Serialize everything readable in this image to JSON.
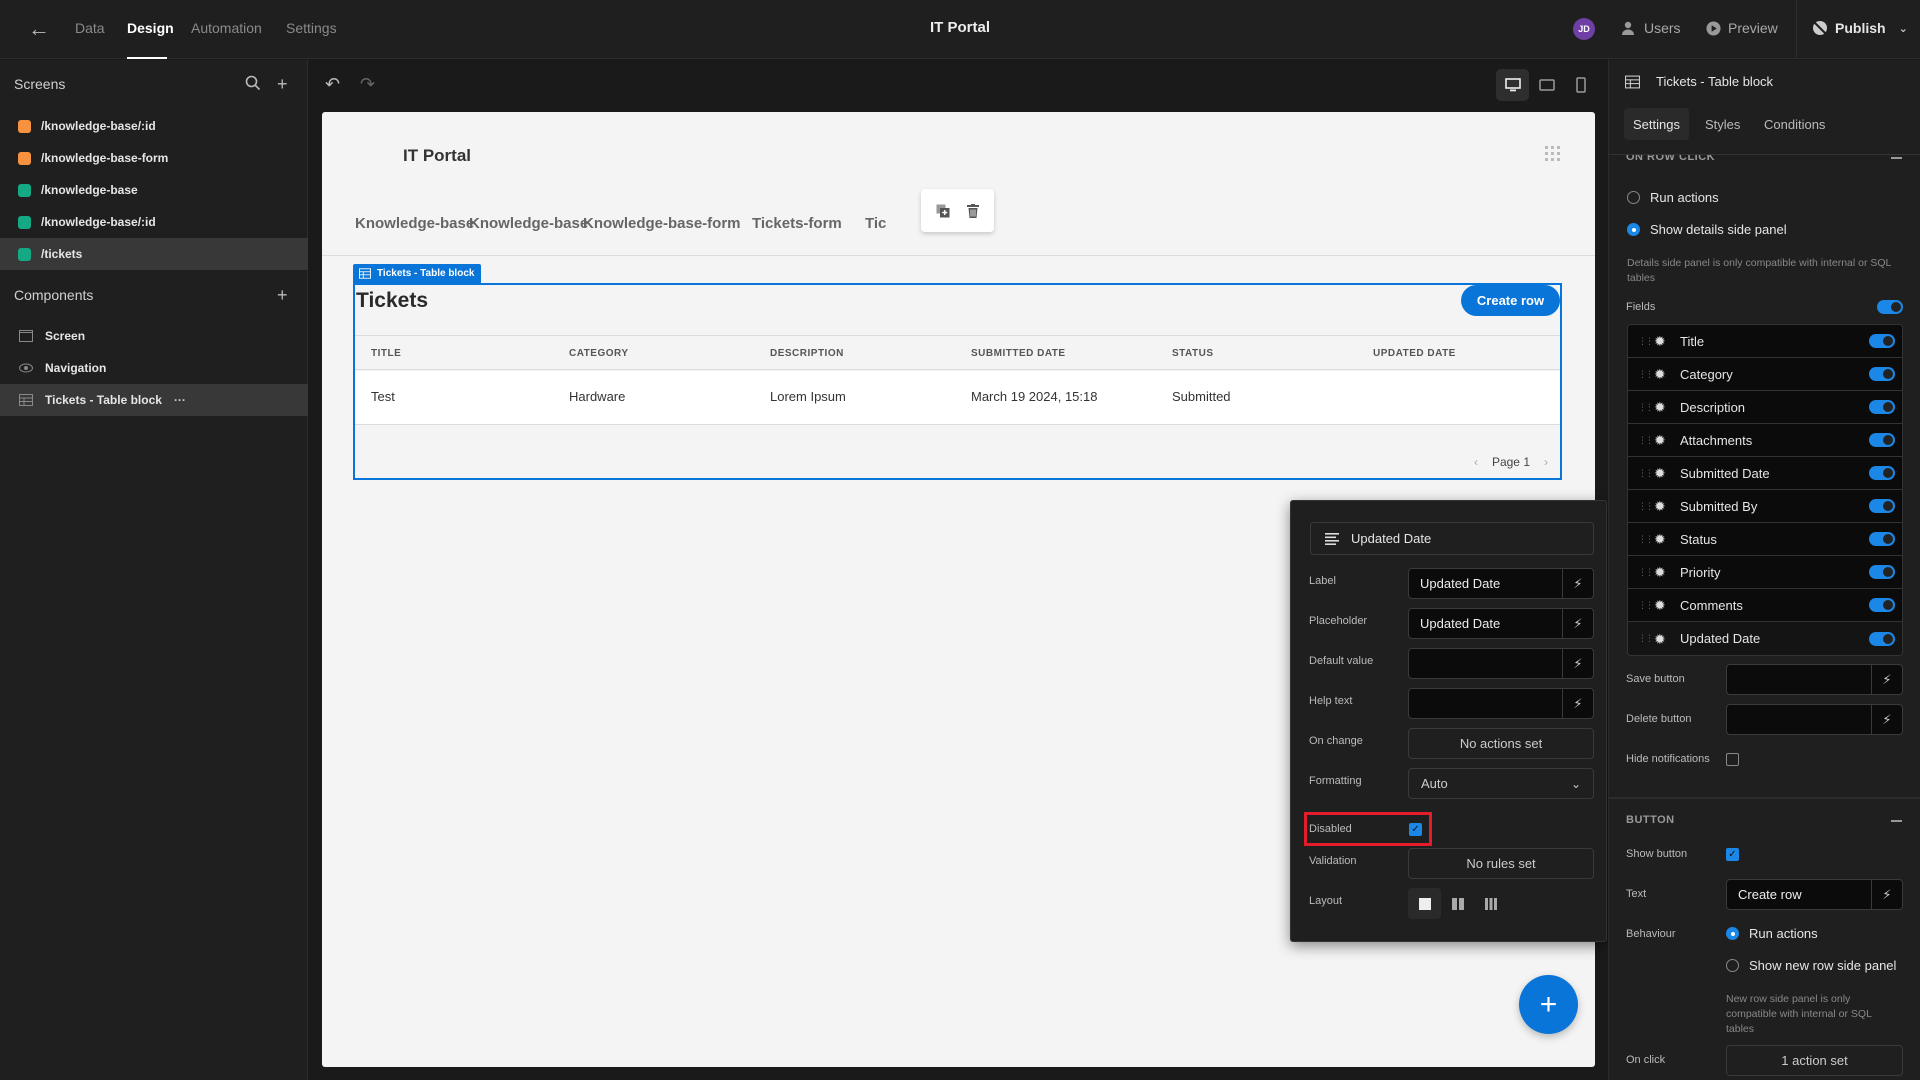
{
  "topbar": {
    "tabs": [
      "Data",
      "Design",
      "Automation",
      "Settings"
    ],
    "active_tab": "Design",
    "app_title": "IT Portal",
    "avatar_initials": "JD",
    "users_label": "Users",
    "preview_label": "Preview",
    "publish_label": "Publish"
  },
  "sidebar": {
    "screens_title": "Screens",
    "screens": [
      {
        "route": "/knowledge-base/:id",
        "color": "#f7923e"
      },
      {
        "route": "/knowledge-base-form",
        "color": "#f7923e"
      },
      {
        "route": "/knowledge-base",
        "color": "#14a884"
      },
      {
        "route": "/knowledge-base/:id",
        "color": "#14a884"
      },
      {
        "route": "/tickets",
        "color": "#14a884",
        "selected": true
      }
    ],
    "components_title": "Components",
    "components": [
      {
        "label": "Screen",
        "icon": "screen-icon"
      },
      {
        "label": "Navigation",
        "icon": "eye-icon"
      },
      {
        "label": "Tickets - Table block",
        "icon": "table-icon",
        "selected": true,
        "more": "···"
      }
    ]
  },
  "canvas": {
    "app_title": "IT Portal",
    "nav_links": [
      "Knowledge-base",
      "Knowledge-base",
      "Knowledge-base-form",
      "Tickets-form",
      "Tic"
    ],
    "block_tag": "Tickets - Table block",
    "table": {
      "title": "Tickets",
      "create_button": "Create row",
      "columns": [
        "TITLE",
        "CATEGORY",
        "DESCRIPTION",
        "SUBMITTED DATE",
        "STATUS",
        "UPDATED DATE"
      ],
      "rows": [
        [
          "Test",
          "Hardware",
          "Lorem Ipsum",
          "March 19 2024, 15:18",
          "Submitted",
          ""
        ]
      ],
      "page_label": "Page 1"
    },
    "fab_label": "+"
  },
  "field_popover": {
    "field_name": "Updated Date",
    "label_label": "Label",
    "label_value": "Updated Date",
    "placeholder_label": "Placeholder",
    "placeholder_value": "Updated Date",
    "default_label": "Default value",
    "default_value": "",
    "help_label": "Help text",
    "help_value": "",
    "onchange_label": "On change",
    "onchange_value": "No actions set",
    "formatting_label": "Formatting",
    "formatting_value": "Auto",
    "disabled_label": "Disabled",
    "disabled_checked": true,
    "validation_label": "Validation",
    "validation_value": "No rules set",
    "layout_label": "Layout",
    "layout_options": [
      "single-column",
      "two-column",
      "three-column"
    ],
    "layout_selected": "single-column"
  },
  "right_panel": {
    "title": "Tickets - Table block",
    "tabs": [
      "Settings",
      "Styles",
      "Conditions"
    ],
    "active_tab": "Settings",
    "on_row_click": {
      "section_title": "ON ROW CLICK",
      "options": [
        "Run actions",
        "Show details side panel"
      ],
      "selected": "Show details side panel",
      "note": "Details side panel is only compatible with internal or SQL tables"
    },
    "fields_label": "Fields",
    "fields_enabled": true,
    "fields": [
      {
        "name": "Title",
        "enabled": true
      },
      {
        "name": "Category",
        "enabled": true
      },
      {
        "name": "Description",
        "enabled": true
      },
      {
        "name": "Attachments",
        "enabled": true
      },
      {
        "name": "Submitted Date",
        "enabled": true
      },
      {
        "name": "Submitted By",
        "enabled": true
      },
      {
        "name": "Status",
        "enabled": true
      },
      {
        "name": "Priority",
        "enabled": true
      },
      {
        "name": "Comments",
        "enabled": true
      },
      {
        "name": "Updated Date",
        "enabled": true
      }
    ],
    "save_button_label": "Save button",
    "save_button_value": "",
    "delete_button_label": "Delete button",
    "delete_button_value": "",
    "hide_notifications_label": "Hide notifications",
    "hide_notifications_checked": false,
    "button_section": {
      "title": "BUTTON",
      "show_button_label": "Show button",
      "show_button_checked": true,
      "text_label": "Text",
      "text_value": "Create row",
      "behaviour_label": "Behaviour",
      "behaviour_options": [
        "Run actions",
        "Show new row side panel"
      ],
      "behaviour_selected": "Run actions",
      "note": "New row side panel is only compatible with internal or SQL tables",
      "on_click_label": "On click",
      "on_click_value": "1 action set"
    }
  },
  "colors": {
    "accent": "#0a75d8",
    "toggle_blue": "#1b87e6",
    "highlight_red": "#e41c2c",
    "avatar": "#6f3fa6"
  }
}
